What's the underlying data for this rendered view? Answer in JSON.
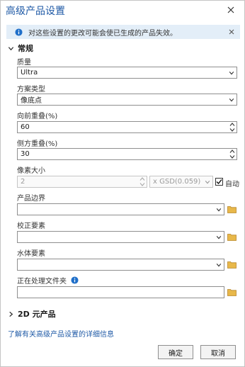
{
  "dialog": {
    "title": "高级产品设置",
    "colors": {
      "title": "#1f5aa6",
      "banner_bg": "#e3eef8",
      "folder": "#e8b84a"
    }
  },
  "banner": {
    "message": "对这些设置的更改可能会使已生成的产品失效。"
  },
  "general": {
    "header": "常规",
    "quality_label": "质量",
    "quality_value": "Ultra",
    "scheme_label": "方案类型",
    "scheme_value": "像底点",
    "forward_overlap_label": "向前重叠(%)",
    "forward_overlap_value": "60",
    "side_overlap_label": "侧方重叠(%)",
    "side_overlap_value": "30",
    "pixel_size_label": "像素大小",
    "pixel_size_value": "2",
    "gsd_value": "x GSD(0.059)",
    "auto_label": "自动",
    "auto_checked": true,
    "boundary_label": "产品边界",
    "boundary_value": "",
    "correction_label": "校正要素",
    "correction_value": "",
    "water_label": "水体要素",
    "water_value": "",
    "processing_folder_label": "正在处理文件夹",
    "processing_folder_value": ""
  },
  "products_2d": {
    "header": "2D 元产品"
  },
  "footer": {
    "learn_more_link": "了解有关高级产品设置的详细信息",
    "ok_label": "确定",
    "cancel_label": "取消"
  }
}
